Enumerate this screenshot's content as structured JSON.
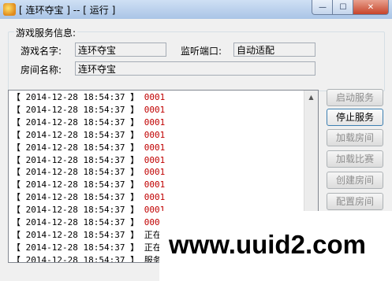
{
  "window": {
    "title": "[ 连环夺宝 ] -- [ 运行 ]",
    "controls": {
      "minimize": "—",
      "maximize": "☐",
      "close": "✕"
    }
  },
  "info": {
    "group_label": "游戏服务信息:",
    "game_name_label": "游戏名字:",
    "game_name_value": "连环夺宝",
    "port_label": "监听端口:",
    "port_value": "自动适配",
    "room_name_label": "房间名称:",
    "room_name_value": "连环夺宝"
  },
  "log": [
    {
      "ts": "【 2014-12-28 18:54:37 】",
      "msg": "0001",
      "kind": "code"
    },
    {
      "ts": "【 2014-12-28 18:54:37 】",
      "msg": "0001",
      "kind": "code"
    },
    {
      "ts": "【 2014-12-28 18:54:37 】",
      "msg": "0001",
      "kind": "code"
    },
    {
      "ts": "【 2014-12-28 18:54:37 】",
      "msg": "0001",
      "kind": "code"
    },
    {
      "ts": "【 2014-12-28 18:54:37 】",
      "msg": "0001",
      "kind": "code"
    },
    {
      "ts": "【 2014-12-28 18:54:37 】",
      "msg": "0001",
      "kind": "code"
    },
    {
      "ts": "【 2014-12-28 18:54:37 】",
      "msg": "0001",
      "kind": "code"
    },
    {
      "ts": "【 2014-12-28 18:54:37 】",
      "msg": "0001",
      "kind": "code"
    },
    {
      "ts": "【 2014-12-28 18:54:37 】",
      "msg": "0001",
      "kind": "code"
    },
    {
      "ts": "【 2014-12-28 18:54:37 】",
      "msg": "0001",
      "kind": "code"
    },
    {
      "ts": "【 2014-12-28 18:54:37 】",
      "msg": "0001",
      "kind": "code"
    },
    {
      "ts": "【 2014-12-28 18:54:37 】",
      "msg": "正在连接",
      "kind": "text"
    },
    {
      "ts": "【 2014-12-28 18:54:37 】",
      "msg": "正在发送",
      "kind": "text"
    },
    {
      "ts": "【 2014-12-28 18:54:37 】",
      "msg": "服务启动",
      "kind": "text"
    }
  ],
  "buttons": [
    {
      "label": "启动服务",
      "enabled": false
    },
    {
      "label": "停止服务",
      "enabled": true
    },
    {
      "label": "加载房间",
      "enabled": false
    },
    {
      "label": "加载比赛",
      "enabled": false
    },
    {
      "label": "创建房间",
      "enabled": false
    },
    {
      "label": "配置房间",
      "enabled": false
    }
  ],
  "watermark": "www.uuid2.com",
  "colors": {
    "code": "#c00000",
    "titlebar": "#b7cfee"
  }
}
